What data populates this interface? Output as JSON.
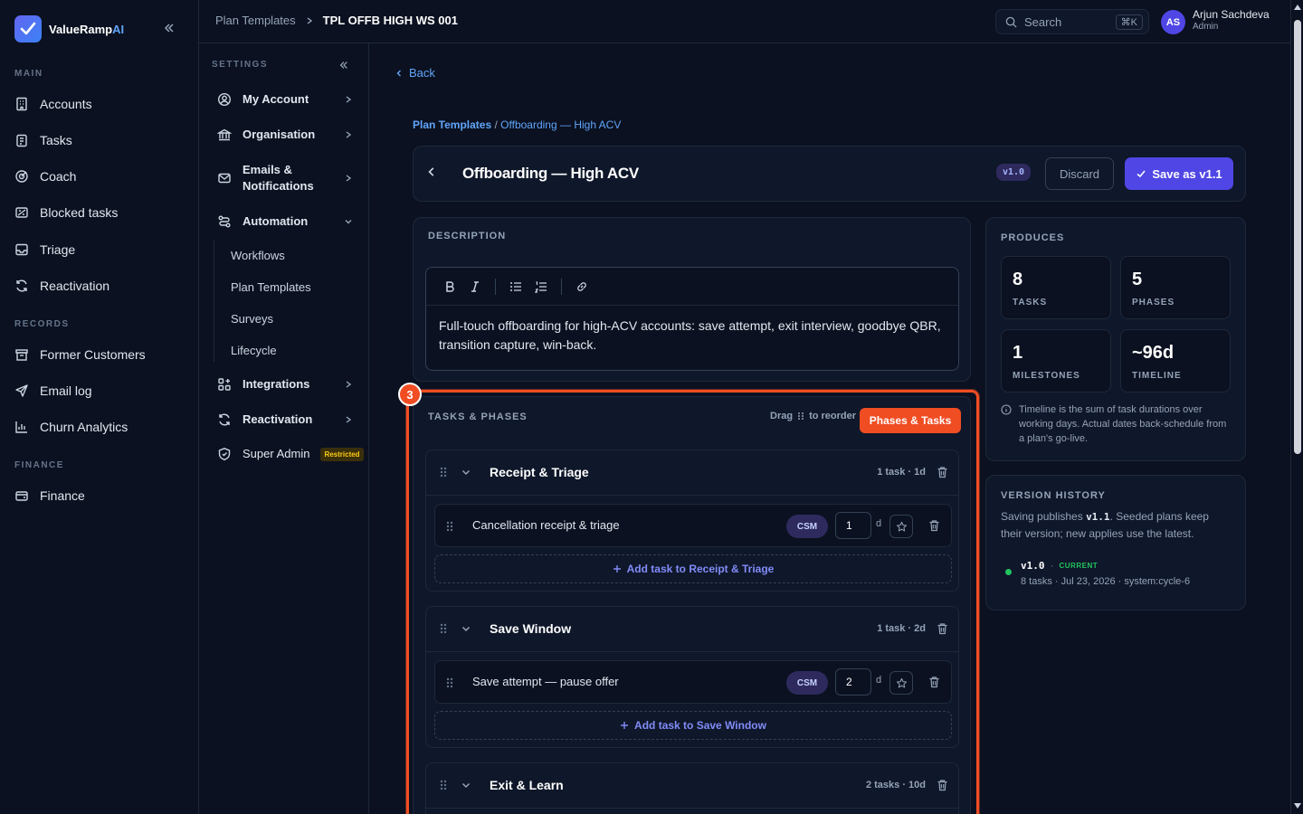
{
  "brand": {
    "name": "ValueRamp",
    "suffix": "AI"
  },
  "sidebar": {
    "main_label": "MAIN",
    "main_items": [
      {
        "label": "Accounts",
        "icon": "building-icon"
      },
      {
        "label": "Tasks",
        "icon": "clipboard-icon"
      },
      {
        "label": "Coach",
        "icon": "target-icon"
      },
      {
        "label": "Blocked tasks",
        "icon": "blocked-icon"
      },
      {
        "label": "Triage",
        "icon": "inbox-icon"
      },
      {
        "label": "Reactivation",
        "icon": "refresh-icon"
      }
    ],
    "records_label": "RECORDS",
    "records_items": [
      {
        "label": "Former Customers",
        "icon": "archive-icon"
      },
      {
        "label": "Email log",
        "icon": "send-icon"
      },
      {
        "label": "Churn Analytics",
        "icon": "chart-icon"
      }
    ],
    "finance_label": "FINANCE",
    "finance_items": [
      {
        "label": "Finance",
        "icon": "wallet-icon"
      }
    ]
  },
  "settings": {
    "label": "SETTINGS",
    "items": {
      "my_account": "My Account",
      "organisation": "Organisation",
      "emails": "Emails & Notifications",
      "automation": "Automation",
      "integrations": "Integrations",
      "reactivation": "Reactivation",
      "super_admin": "Super Admin"
    },
    "automation_sub": [
      "Workflows",
      "Plan Templates",
      "Surveys",
      "Lifecycle"
    ],
    "restricted_badge": "Restricted"
  },
  "topbar": {
    "crumb_parent": "Plan Templates",
    "crumb_current": "TPL OFFB HIGH WS 001",
    "search_placeholder": "Search",
    "search_shortcut": "⌘K",
    "user_initials": "AS",
    "user_name": "Arjun Sachdeva",
    "user_role": "Admin"
  },
  "page": {
    "back": "Back",
    "path_parent": "Plan Templates",
    "path_sep": " / ",
    "path_current": "Offboarding — High ACV",
    "title": "Offboarding — High ACV",
    "version": "v1.0",
    "discard": "Discard",
    "save": "Save as v1.1"
  },
  "description": {
    "label": "DESCRIPTION",
    "text": "Full-touch offboarding for high-ACV accounts: save attempt, exit interview, goodbye QBR, transition capture, win-back."
  },
  "produces": {
    "label": "PRODUCES",
    "tasks": {
      "value": "8",
      "label": "TASKS"
    },
    "phases": {
      "value": "5",
      "label": "PHASES"
    },
    "milestones": {
      "value": "1",
      "label": "MILESTONES"
    },
    "timeline": {
      "value": "~96d",
      "label": "TIMELINE"
    },
    "note": "Timeline is the sum of task durations over working days. Actual dates back-schedule from a plan's go-live."
  },
  "version_history": {
    "label": "VERSION HISTORY",
    "desc_pre": "Saving publishes ",
    "desc_ver": "v1.1",
    "desc_post": ". Seeded plans keep their version; new applies use the latest.",
    "entry_version": "v1.0",
    "entry_sep": "·",
    "entry_tag": "CURRENT",
    "entry_detail": "8 tasks · Jul 23, 2026 · system:cycle-6"
  },
  "tasks_phases": {
    "label": "TASKS & PHASES",
    "step_badge": "3",
    "drag_pre": "Drag",
    "drag_post": "to reorder",
    "phases_button": "Phases & Tasks",
    "phases": [
      {
        "title": "Receipt & Triage",
        "meta": "1 task · 1d",
        "task": "Cancellation receipt & triage",
        "role": "CSM",
        "duration": "1",
        "unit": "d",
        "add": "Add task to Receipt & Triage"
      },
      {
        "title": "Save Window",
        "meta": "1 task · 2d",
        "task": "Save attempt — pause offer",
        "role": "CSM",
        "duration": "2",
        "unit": "d",
        "add": "Add task to Save Window"
      },
      {
        "title": "Exit & Learn",
        "meta": "2 tasks · 10d"
      }
    ]
  }
}
